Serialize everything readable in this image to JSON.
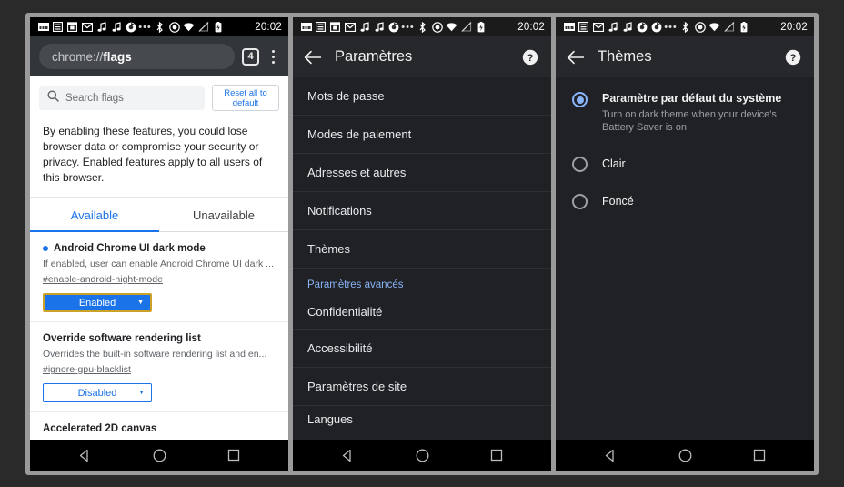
{
  "statusbar": {
    "time": "20:02",
    "icons_left_phone1": [
      "keyboard-icon",
      "article-icon",
      "calendar-icon",
      "gmail-icon",
      "music-note-icon",
      "music-note-icon",
      "chrome-icon"
    ],
    "icons_left_phone3": [
      "keyboard-icon",
      "article-icon",
      "gmail-icon",
      "music-note-icon",
      "music-note-icon",
      "chrome-icon",
      "chrome-icon"
    ],
    "icons_right": [
      "overflow-dots-icon",
      "bluetooth-icon",
      "location-icon",
      "wifi-icon",
      "signal-off-icon",
      "battery-charging-icon"
    ]
  },
  "phone1": {
    "toolbar": {
      "url_prefix": "chrome://",
      "url_bold": "flags",
      "tab_count": "4",
      "menu_icon": "kebab-menu-icon"
    },
    "search": {
      "placeholder": "Search flags",
      "icon": "search-icon"
    },
    "reset_label": "Reset all to default",
    "warning": "By enabling these features, you could lose browser data or compromise your security or privacy. Enabled features apply to all users of this browser.",
    "tabs": [
      {
        "label": "Available",
        "active": true
      },
      {
        "label": "Unavailable",
        "active": false
      }
    ],
    "flags": [
      {
        "title": "Android Chrome UI dark mode",
        "desc": "If enabled, user can enable Android Chrome UI dark ...",
        "anchor": "#enable-android-night-mode",
        "select_value": "Enabled",
        "select_state": "enabled"
      },
      {
        "title": "Override software rendering list",
        "desc": "Overrides the built-in software rendering list and en...",
        "anchor": "#ignore-gpu-blacklist",
        "select_value": "Disabled",
        "select_state": "disabled"
      },
      {
        "title": "Accelerated 2D canvas",
        "desc": "",
        "anchor": "",
        "select_value": "",
        "select_state": ""
      }
    ]
  },
  "phone2": {
    "appbar": {
      "title": "Paramètres",
      "back_icon": "back-arrow-icon",
      "help_icon": "help-icon"
    },
    "items": [
      {
        "label": "Mots de passe"
      },
      {
        "label": "Modes de paiement"
      },
      {
        "label": "Adresses et autres"
      },
      {
        "label": "Notifications"
      },
      {
        "label": "Thèmes"
      }
    ],
    "section_header": "Paramètres avancés",
    "advanced_items": [
      {
        "label": "Confidentialité"
      },
      {
        "label": "Accessibilité"
      },
      {
        "label": "Paramètres de site"
      },
      {
        "label": "Langues"
      }
    ]
  },
  "phone3": {
    "appbar": {
      "title": "Thèmes",
      "back_icon": "back-arrow-icon",
      "help_icon": "help-icon"
    },
    "options": [
      {
        "label": "Paramètre par défaut du système",
        "sub": "Turn on dark theme when your device's Battery Saver is on",
        "checked": true
      },
      {
        "label": "Clair",
        "sub": "",
        "checked": false
      },
      {
        "label": "Foncé",
        "sub": "",
        "checked": false
      }
    ]
  },
  "navbar": {
    "back": "nav-back-icon",
    "home": "nav-home-icon",
    "recents": "nav-recents-icon"
  },
  "colors": {
    "accent_blue": "#1a73e8",
    "dark_accent": "#8ab4f8",
    "dark_bg": "#202124",
    "appbar_bg": "#26282b",
    "focus_border": "#c9a227"
  }
}
